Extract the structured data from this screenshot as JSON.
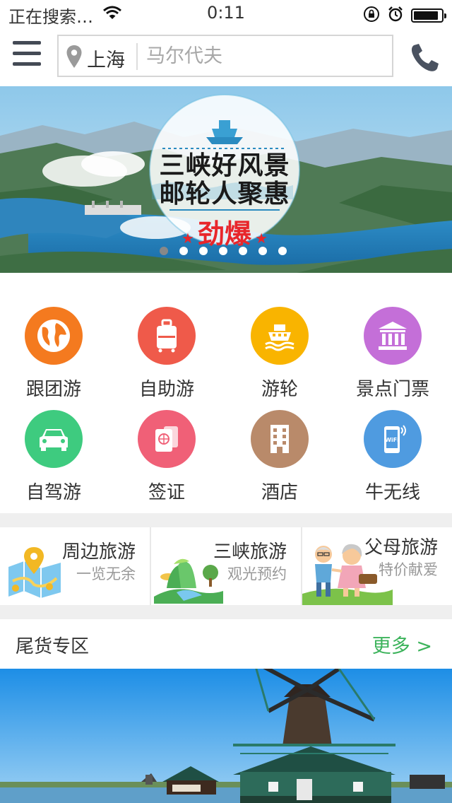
{
  "status_bar": {
    "carrier": "正在搜索…",
    "time": "0:11"
  },
  "search": {
    "city": "上海",
    "placeholder": "马尔代夫"
  },
  "banner": {
    "headline_line1": "三峡好风景",
    "headline_line2": "邮轮人聚惠",
    "tag": "劲爆",
    "slide_count": 7,
    "active_slide": 1
  },
  "categories": [
    {
      "label": "跟团游",
      "icon": "globe-icon",
      "color": "#f47a1f"
    },
    {
      "label": "自助游",
      "icon": "suitcase-icon",
      "color": "#ef5a4a"
    },
    {
      "label": "游轮",
      "icon": "ship-icon",
      "color": "#f9b400"
    },
    {
      "label": "景点门票",
      "icon": "temple-icon",
      "color": "#c46fd8"
    },
    {
      "label": "自驾游",
      "icon": "car-icon",
      "color": "#3ecb7f"
    },
    {
      "label": "签证",
      "icon": "passport-icon",
      "color": "#f06077"
    },
    {
      "label": "酒店",
      "icon": "hotel-icon",
      "color": "#b98a6a"
    },
    {
      "label": "牛无线",
      "icon": "wifi-phone-icon",
      "color": "#4f9be0"
    }
  ],
  "features": [
    {
      "title": "周边旅游",
      "subtitle": "一览无余",
      "icon": "map-pin-illustration"
    },
    {
      "title": "三峡旅游",
      "subtitle": "观光预约",
      "icon": "mountain-illustration"
    },
    {
      "title": "父母旅游",
      "subtitle": "特价献爱",
      "icon": "elderly-couple-illustration"
    }
  ],
  "section": {
    "title": "尾货专区",
    "more": "更多 >"
  },
  "colors": {
    "accent_green": "#3cb35b",
    "banner_red": "#e8262b"
  }
}
